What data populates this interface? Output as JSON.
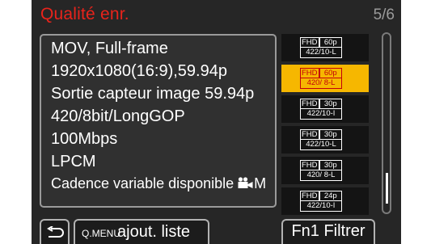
{
  "menu": {
    "title": "Qualité enr.",
    "page_indicator": "5/6"
  },
  "info": {
    "lines": [
      "MOV, Full-frame",
      "1920x1080(16:9),59.94p",
      "Sortie capteur image 59.94p",
      "420/8bit/LongGOP",
      "100Mbps",
      "LPCM",
      "Cadence variable disponible"
    ],
    "vfr_icon": "movie-camera-icon",
    "vfr_icon_suffix": "M"
  },
  "list": {
    "items": [
      {
        "res": "FHD",
        "rate": "60p",
        "format": "422/10-L",
        "selected": false
      },
      {
        "res": "FHD",
        "rate": "60p",
        "format": "420/ 8-L",
        "selected": true
      },
      {
        "res": "FHD",
        "rate": "30p",
        "format": "422/10-I",
        "selected": false
      },
      {
        "res": "FHD",
        "rate": "30p",
        "format": "422/10-L",
        "selected": false
      },
      {
        "res": "FHD",
        "rate": "30p",
        "format": "420/ 8-L",
        "selected": false
      },
      {
        "res": "FHD",
        "rate": "24p",
        "format": "422/10-I",
        "selected": false
      }
    ]
  },
  "buttons": {
    "back_icon": "return-arrow-icon",
    "add_list_key": "Q.MENU",
    "add_list_label": "ajout. liste",
    "filter_label": "Fn1 Filtrer"
  },
  "colors": {
    "title": "#e8231b",
    "selected": "#f6b700",
    "background": "#262626"
  }
}
